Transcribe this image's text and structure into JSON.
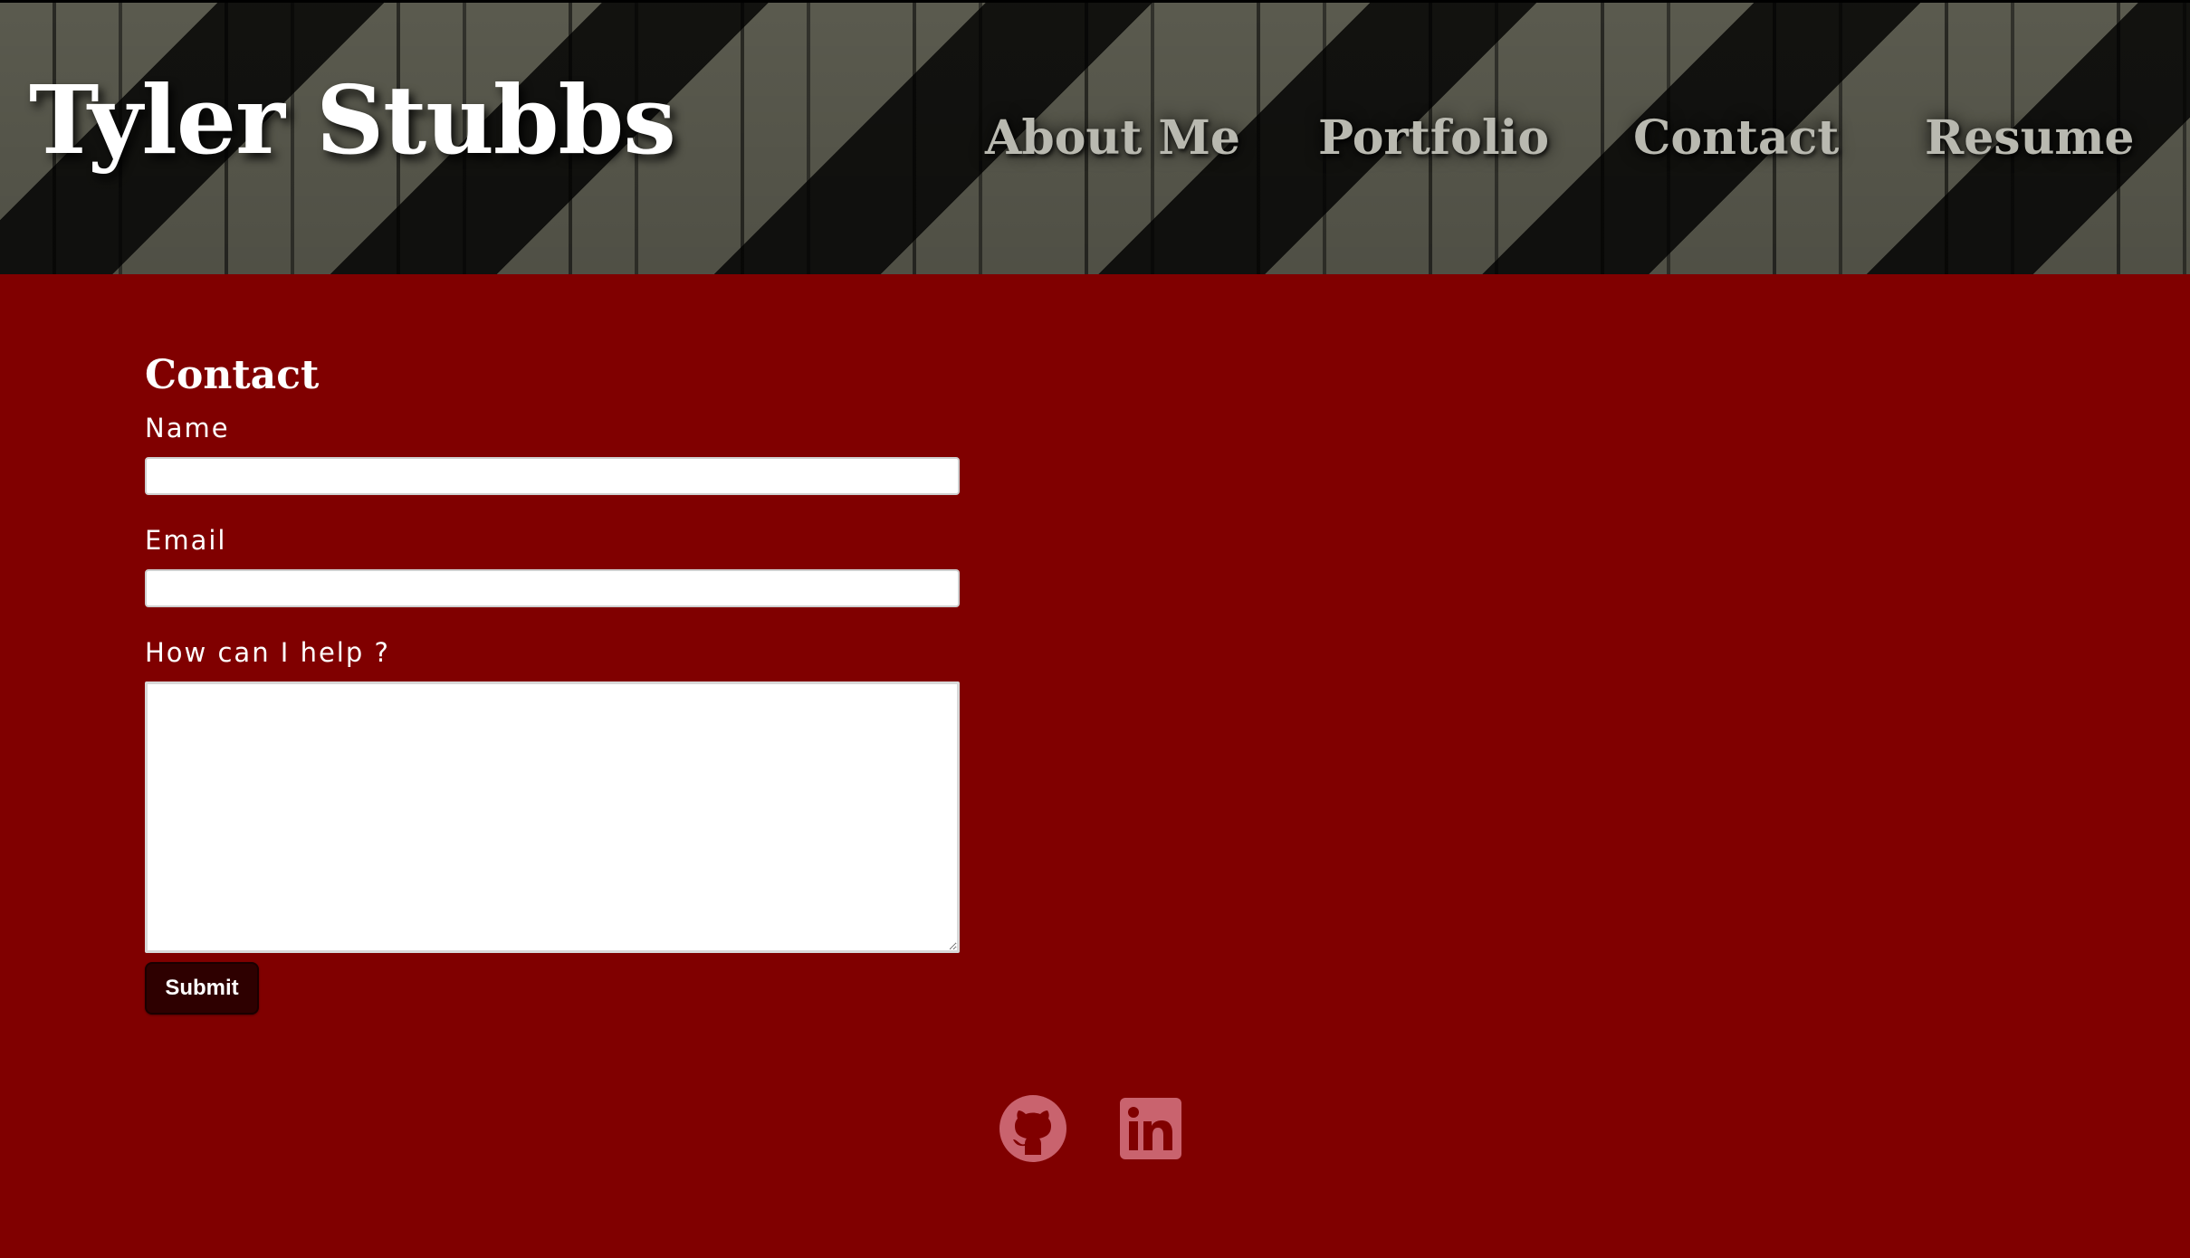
{
  "header": {
    "site_title": "Tyler Stubbs",
    "nav": [
      {
        "label": "About Me"
      },
      {
        "label": "Portfolio"
      },
      {
        "label": "Contact"
      },
      {
        "label": "Resume"
      }
    ]
  },
  "contact": {
    "title": "Contact",
    "name_label": "Name",
    "name_value": "",
    "email_label": "Email",
    "email_value": "",
    "help_label": "How can I help ?",
    "help_value": "",
    "submit_label": "Submit"
  },
  "social": {
    "icons": [
      "github-icon",
      "linkedin-icon"
    ]
  },
  "colors": {
    "background": "#800000",
    "button": "#2e0000",
    "icon": "#c9636e",
    "nav_text": "#b9b9b0"
  }
}
